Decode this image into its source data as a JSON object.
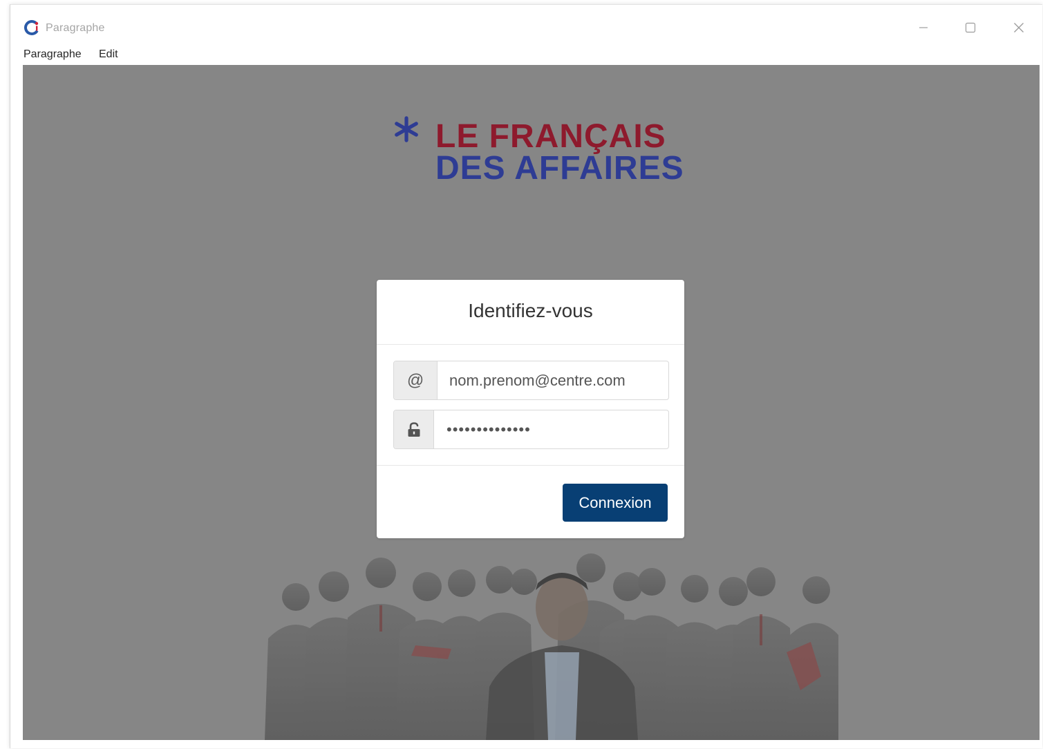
{
  "window": {
    "title": "Paragraphe",
    "icon": "ci-logo-icon",
    "controls": [
      "minimize-icon",
      "maximize-icon",
      "close-icon"
    ]
  },
  "menu": {
    "items": [
      {
        "label": "Paragraphe"
      },
      {
        "label": "Edit"
      }
    ]
  },
  "logo": {
    "line1": "LE FRANÇAIS",
    "line2": "DES AFFAIRES",
    "star_color": "#2e3c94",
    "line1_color": "#8e1a2d",
    "line2_color": "#2e3c94"
  },
  "login": {
    "title": "Identifiez-vous",
    "email_addon": "@",
    "email_value": "nom.prenom@centre.com",
    "password_icon": "unlock-icon",
    "password_value": "••••••••••••••",
    "submit_label": "Connexion",
    "button_color": "#083f74"
  },
  "background": {
    "color": "#868686",
    "image": "business-people-group"
  }
}
